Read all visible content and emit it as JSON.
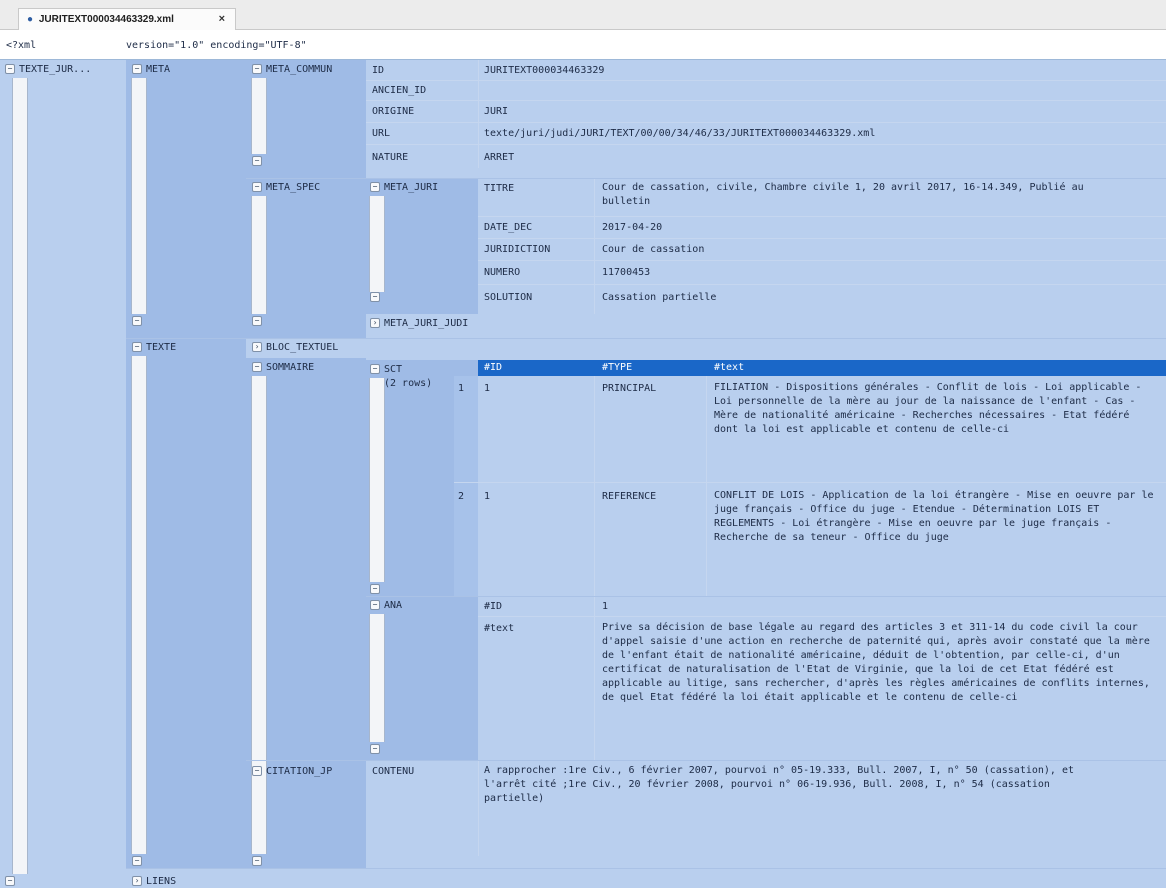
{
  "tab": {
    "modified": "●",
    "title": "JURITEXT000034463329.xml",
    "close": "×"
  },
  "xml_decl": {
    "tag": "<?xml",
    "attrs": "version=\"1.0\" encoding=\"UTF-8\""
  },
  "tree": {
    "root": "TEXTE_JUR...",
    "meta": "META",
    "meta_commun": {
      "label": "META_COMMUN",
      "rows": [
        {
          "key": "ID",
          "value": "JURITEXT000034463329"
        },
        {
          "key": "ANCIEN_ID",
          "value": ""
        },
        {
          "key": "ORIGINE",
          "value": "JURI"
        },
        {
          "key": "URL",
          "value": "texte/juri/judi/JURI/TEXT/00/00/34/46/33/JURITEXT000034463329.xml"
        },
        {
          "key": "NATURE",
          "value": "ARRET"
        }
      ]
    },
    "meta_spec": {
      "label": "META_SPEC",
      "meta_juri": "META_JURI",
      "rows": [
        {
          "key": "TITRE",
          "value": "Cour de cassation, civile, Chambre civile 1, 20 avril 2017, 16-14.349, Publié au bulletin"
        },
        {
          "key": "DATE_DEC",
          "value": "2017-04-20"
        },
        {
          "key": "JURIDICTION",
          "value": "Cour de cassation"
        },
        {
          "key": "NUMERO",
          "value": "11700453"
        },
        {
          "key": "SOLUTION",
          "value": "Cassation partielle"
        }
      ],
      "meta_juri_judi": "META_JURI_JUDI"
    },
    "texte": "TEXTE",
    "bloc_textuel": "BLOC_TEXTUEL",
    "sommaire": "SOMMAIRE",
    "sct": {
      "label": "SCT",
      "count": "(2 rows)",
      "columns": [
        "#ID",
        "#TYPE",
        "#text"
      ],
      "rows": [
        {
          "n": "1",
          "id": "1",
          "type": "PRINCIPAL",
          "text": "FILIATION - Dispositions générales -  Conflit de lois -  Loi applicable -  Loi personnelle de la mère au jour de la naissance de l'enfant -  Cas -  Mère de nationalité américaine - Recherches nécessaires - Etat fédéré dont la loi est applicable et contenu de celle-ci"
        },
        {
          "n": "2",
          "id": "1",
          "type": "REFERENCE",
          "text": "CONFLIT DE LOIS -  Application de la loi étrangère -  Mise en oeuvre par le juge français -  Office du juge -  Etendue -  Détermination LOIS ET REGLEMENTS -  Loi étrangère -  Mise en oeuvre par le juge français -  Recherche de sa teneur - Office du juge"
        }
      ]
    },
    "ana": {
      "label": "ANA",
      "id_key": "#ID",
      "id_value": "1",
      "text_key": "#text",
      "text_value": "Prive sa décision de base légale au regard des articles 3 et 311-14 du code civil la cour d'appel saisie d'une action en recherche de paternité qui, après avoir constaté que la mère de l'enfant était de nationalité américaine, déduit de l'obtention, par celle-ci, d'un certificat de naturalisation de l'Etat de Virginie, que la loi de cet Etat fédéré est applicable au litige, sans rechercher, d'après les règles américaines de conflits internes, de quel Etat fédéré la loi était applicable et le contenu de celle-ci"
    },
    "citation": {
      "label": "CITATION_JP",
      "key": "CONTENU",
      "value": "A rapprocher :1re Civ., 6 février 2007, pourvoi n° 05-19.333, Bull. 2007, I, n° 50 (cassation), et l'arrêt cité ;1re Civ., 20 février 2008, pourvoi n° 06-19.936, Bull. 2008, I, n° 54 (cassation partielle)"
    },
    "liens": "LIENS"
  },
  "icons": {
    "collapse": "collapse-toggle-icon",
    "expand": "expand-toggle-icon"
  }
}
